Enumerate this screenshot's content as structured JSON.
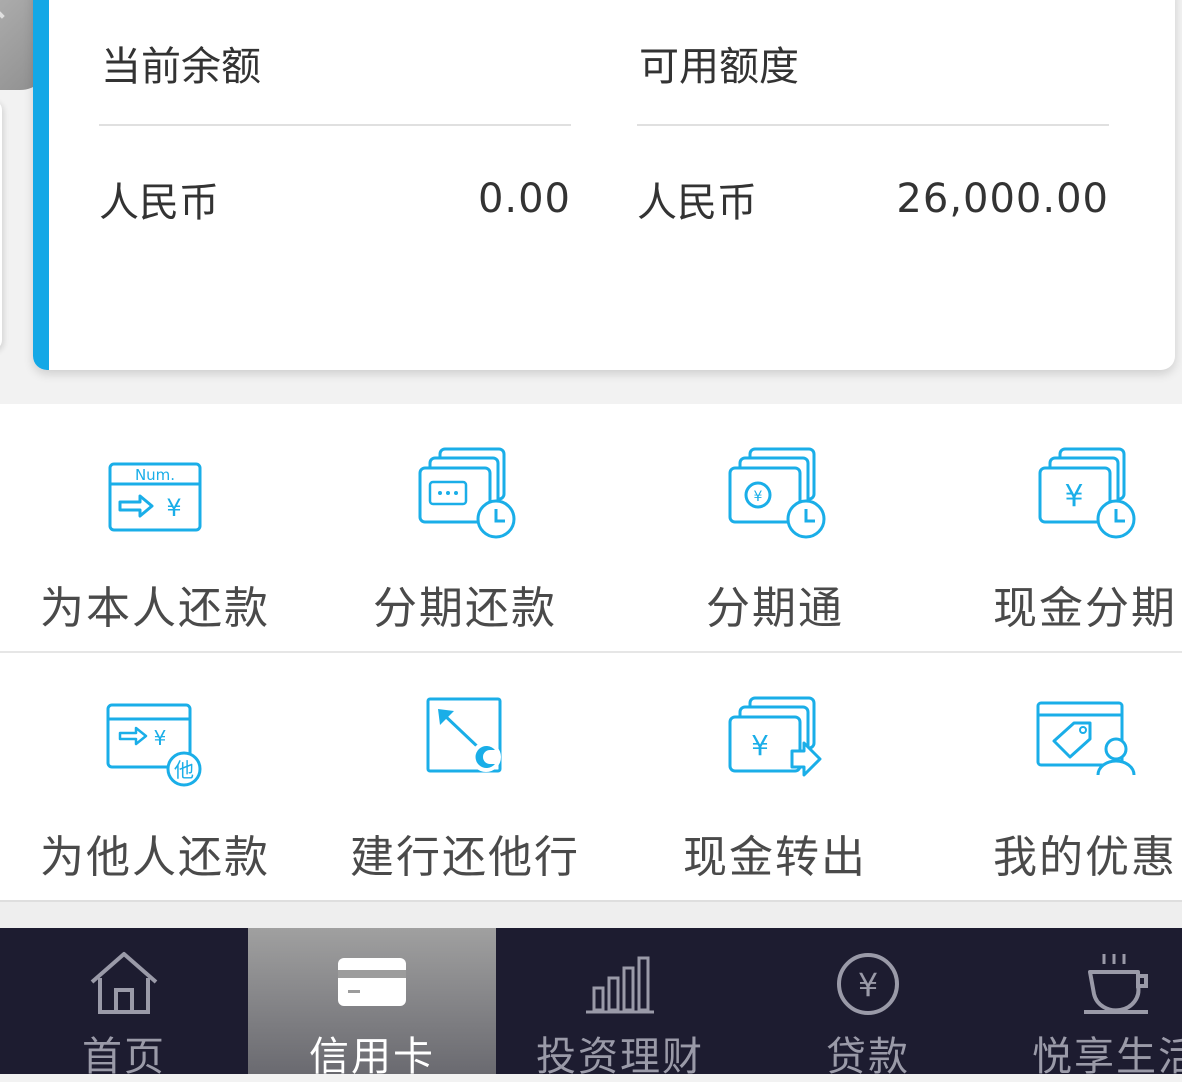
{
  "card": {
    "left": {
      "title": "当前余额",
      "currency": "人民币",
      "amount": "0.00"
    },
    "right": {
      "title": "可用额度",
      "currency": "人民币",
      "amount": "26,000.00"
    }
  },
  "menu": {
    "row1": [
      {
        "label": "为本人还款",
        "icon_text": "Num."
      },
      {
        "label": "分期还款"
      },
      {
        "label": "分期通"
      },
      {
        "label": "现金分期"
      }
    ],
    "row2": [
      {
        "label": "为他人还款",
        "icon_text": "他"
      },
      {
        "label": "建行还他行"
      },
      {
        "label": "现金转出"
      },
      {
        "label": "我的优惠"
      }
    ]
  },
  "tabbar": [
    {
      "label": "首页"
    },
    {
      "label": "信用卡"
    },
    {
      "label": "投资理财"
    },
    {
      "label": "贷款"
    },
    {
      "label": "悦享生活"
    }
  ],
  "colors": {
    "accent": "#13a8e6",
    "icon": "#1aaee8",
    "tabbar_bg": "#1d1c30"
  }
}
